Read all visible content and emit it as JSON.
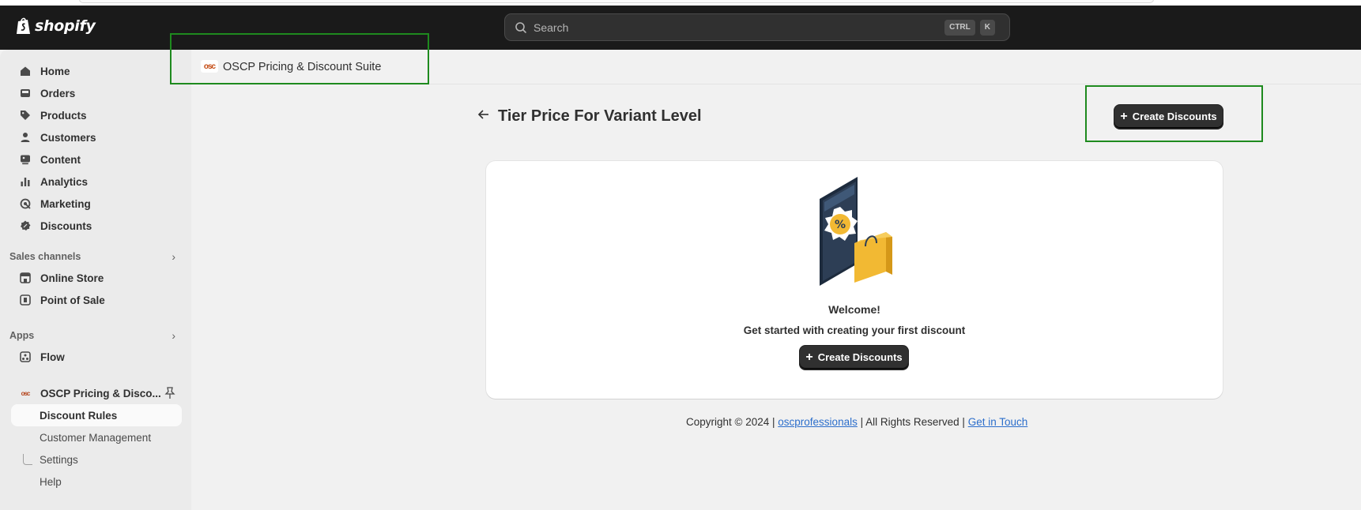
{
  "topbar": {
    "brand": "shopify",
    "search_placeholder": "Search",
    "kbd_ctrl": "CTRL",
    "kbd_k": "K"
  },
  "sidebar": {
    "items": [
      {
        "label": "Home",
        "icon": "home-icon"
      },
      {
        "label": "Orders",
        "icon": "orders-icon"
      },
      {
        "label": "Products",
        "icon": "tag-icon"
      },
      {
        "label": "Customers",
        "icon": "person-icon"
      },
      {
        "label": "Content",
        "icon": "content-icon"
      },
      {
        "label": "Analytics",
        "icon": "bar-chart-icon"
      },
      {
        "label": "Marketing",
        "icon": "target-icon"
      },
      {
        "label": "Discounts",
        "icon": "discount-icon"
      }
    ],
    "sales_channels_heading": "Sales channels",
    "sales_channels": [
      {
        "label": "Online Store",
        "icon": "store-icon"
      },
      {
        "label": "Point of Sale",
        "icon": "pos-icon"
      }
    ],
    "apps_heading": "Apps",
    "apps": [
      {
        "label": "Flow",
        "icon": "flow-icon"
      }
    ],
    "pinned_app": {
      "label": "OSCP Pricing & Disco...",
      "logo": "osc"
    },
    "pinned_app_subitems": [
      {
        "label": "Discount Rules",
        "active": true
      },
      {
        "label": "Customer Management"
      },
      {
        "label": "Settings"
      },
      {
        "label": "Help"
      }
    ]
  },
  "app_header": {
    "logo": "osc",
    "name": "OSCP Pricing & Discount Suite"
  },
  "page": {
    "title": "Tier Price For Variant Level",
    "primary_action": "Create Discounts"
  },
  "card": {
    "welcome": "Welcome!",
    "subtext": "Get started with creating your first discount",
    "cta": "Create Discounts"
  },
  "footer": {
    "prefix": "Copyright © 2024 |",
    "link1": "oscprofessionals",
    "middle": "| All Rights Reserved |",
    "link2": "Get in Touch"
  },
  "colors": {
    "topbar_bg": "#1a1a1a",
    "highlight_border": "#1e8a1e",
    "button_dark": "#303030",
    "link": "#2c6ecb",
    "illustration_yellow": "#f2b933",
    "illustration_navy": "#2d3e55"
  }
}
